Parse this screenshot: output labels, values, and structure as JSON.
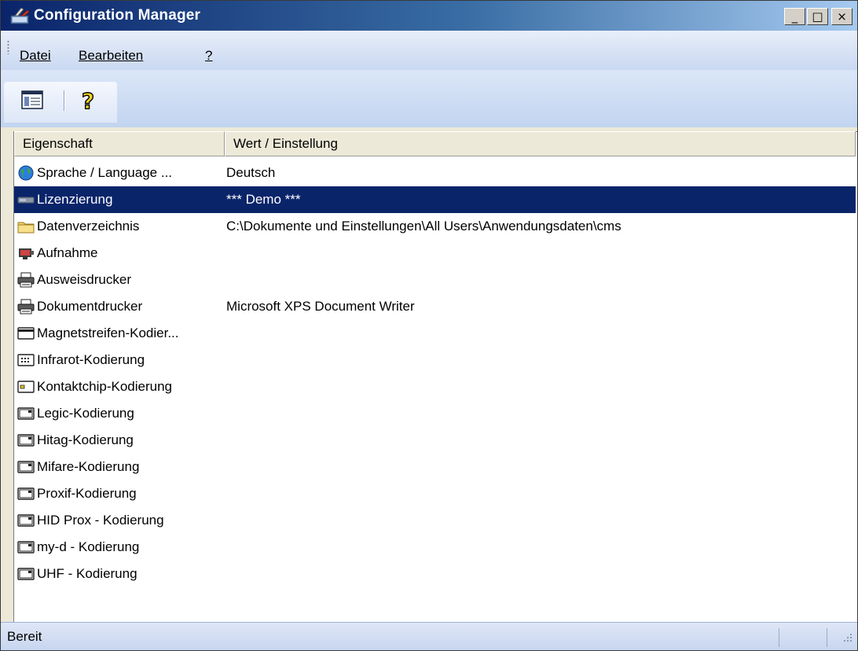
{
  "window": {
    "title": "Configuration Manager",
    "controls": {
      "minimize": "_",
      "maximize": "□",
      "close": "×"
    }
  },
  "menu": {
    "datei": "Datei",
    "bearbeiten": "Bearbeiten",
    "help": "?"
  },
  "toolbar": {
    "properties_icon": "properties-icon",
    "help_icon": "help-icon"
  },
  "columns": {
    "property": "Eigenschaft",
    "value": "Wert / Einstellung"
  },
  "rows": [
    {
      "label": "Sprache / Language ...",
      "value": "Deutsch",
      "icon": "globe-icon",
      "selected": false
    },
    {
      "label": "Lizenzierung",
      "value": "*** Demo ***",
      "icon": "license-key-icon",
      "selected": true
    },
    {
      "label": "Datenverzeichnis",
      "value": "C:\\Dokumente und Einstellungen\\All Users\\Anwendungsdaten\\cms",
      "icon": "folder-icon",
      "selected": false
    },
    {
      "label": "Aufnahme",
      "value": "",
      "icon": "camera-icon",
      "selected": false
    },
    {
      "label": "Ausweisdrucker",
      "value": "",
      "icon": "printer-icon",
      "selected": false
    },
    {
      "label": "Dokumentdrucker",
      "value": "Microsoft XPS Document Writer",
      "icon": "printer-icon",
      "selected": false
    },
    {
      "label": "Magnetstreifen-Kodier...",
      "value": "",
      "icon": "magstripe-card-icon",
      "selected": false
    },
    {
      "label": "Infrarot-Kodierung",
      "value": "",
      "icon": "infrared-card-icon",
      "selected": false
    },
    {
      "label": "Kontaktchip-Kodierung",
      "value": "",
      "icon": "chip-card-icon",
      "selected": false
    },
    {
      "label": "Legic-Kodierung",
      "value": "",
      "icon": "rfid-card-icon",
      "selected": false
    },
    {
      "label": "Hitag-Kodierung",
      "value": "",
      "icon": "rfid-card-icon",
      "selected": false
    },
    {
      "label": "Mifare-Kodierung",
      "value": "",
      "icon": "rfid-card-icon",
      "selected": false
    },
    {
      "label": "Proxif-Kodierung",
      "value": "",
      "icon": "rfid-card-icon",
      "selected": false
    },
    {
      "label": "HID Prox - Kodierung",
      "value": "",
      "icon": "rfid-card-icon",
      "selected": false
    },
    {
      "label": "my-d - Kodierung",
      "value": "",
      "icon": "rfid-card-icon",
      "selected": false
    },
    {
      "label": "UHF - Kodierung",
      "value": "",
      "icon": "rfid-card-icon",
      "selected": false
    }
  ],
  "status": {
    "text": "Bereit"
  },
  "colors": {
    "title_dark": "#0a246a",
    "title_light": "#a6caf0",
    "selection": "#0a246a",
    "chrome": "#c9d8f1"
  }
}
